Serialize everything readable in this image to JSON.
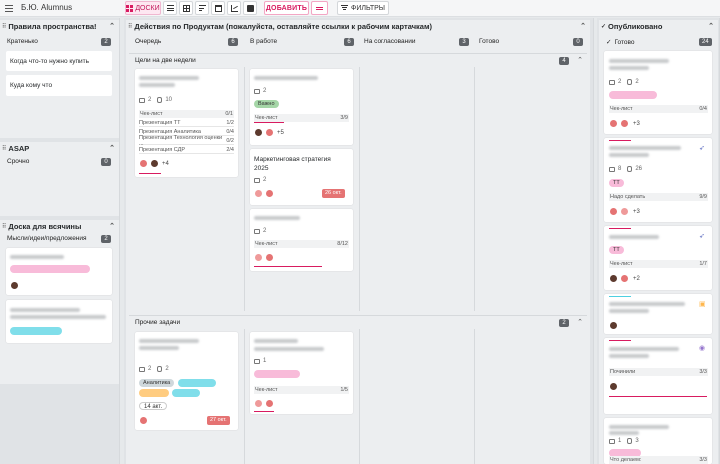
{
  "topbar": {
    "workspace": "Б.Ю. Alumnus",
    "view_boards": "ДОСКИ",
    "add_label": "ДОБАВИТЬ",
    "filters_label": "ФИЛЬТРЫ"
  },
  "left_panels": [
    {
      "title": "Правила пространства!",
      "column": "Кратенько",
      "count": "2",
      "cards": [
        "Когда что-то нужно купить",
        "Куда кому что"
      ]
    },
    {
      "title": "ASAP",
      "column": "Срочно",
      "count": "0"
    },
    {
      "title": "Доска для всячины",
      "column": "Мысли/идеи/предложения",
      "count": "2"
    }
  ],
  "main_board": {
    "title": "Действия по Продуктам (пожалуйста, оставляйте ссылки к рабочим картачкам)",
    "columns": [
      {
        "name": "Очередь",
        "count": "6"
      },
      {
        "name": "В работе",
        "count": "6"
      },
      {
        "name": "На согласовании",
        "count": "3"
      },
      {
        "name": "Готово",
        "count": "0"
      }
    ],
    "lanes": [
      {
        "title": "Цели на две недели",
        "count": "4"
      },
      {
        "title": "Прочие задачи",
        "count": "2"
      }
    ]
  },
  "cards": {
    "queue1": {
      "comments": "2",
      "files": "10",
      "checklist_title": "Чек-лист",
      "checklist_count": "0/1",
      "items": [
        {
          "label": "Презентация ТТ",
          "value": "1/2"
        },
        {
          "label": "Презентация Аналитика",
          "value": "0/4"
        },
        {
          "label": "Презентация Технология оценки ...",
          "value": "0/2"
        },
        {
          "label": "Презентация СДР",
          "value": "2/4"
        }
      ],
      "more": "+4"
    },
    "work1": {
      "comments": "2",
      "tag": "Важно",
      "checklist_title": "Чек-лист",
      "checklist_count": "3/9",
      "more": "+5"
    },
    "work2": {
      "title": "Маркетинговая стратегия 2025",
      "comments": "2",
      "due": "26 окт."
    },
    "work3": {
      "comments": "2",
      "checklist_title": "Чек-лист",
      "checklist_count": "8/12"
    },
    "other1": {
      "comments": "2",
      "files": "2",
      "tags": [
        "Аналитика"
      ],
      "date": "14 акт.",
      "due": "27 окт."
    },
    "other2": {
      "comments": "1",
      "checklist_title": "Чек-лист",
      "checklist_count": "1/5"
    }
  },
  "right_panel": {
    "title": "Опубликовано",
    "column": "Готово",
    "count": "24",
    "cards": [
      {
        "comments": "2",
        "files": "2",
        "check_label": "Чек-лист",
        "check_value": "0/4",
        "more": "+3"
      },
      {
        "comments": "8",
        "files": "26",
        "tag": "ТТ",
        "check_label": "Надо сделать",
        "check_value": "9/9",
        "more": "+3"
      },
      {
        "tag": "ТТ",
        "check_label": "Чек-лист",
        "check_value": "1/7",
        "more": "+2"
      },
      {
        "check_label": "",
        "check_value": ""
      },
      {
        "check_label": "Починили",
        "check_value": "3/3"
      },
      {
        "comments": "1",
        "files": "3",
        "check_label": "Что делаем:",
        "check_value": "3/3"
      }
    ]
  }
}
